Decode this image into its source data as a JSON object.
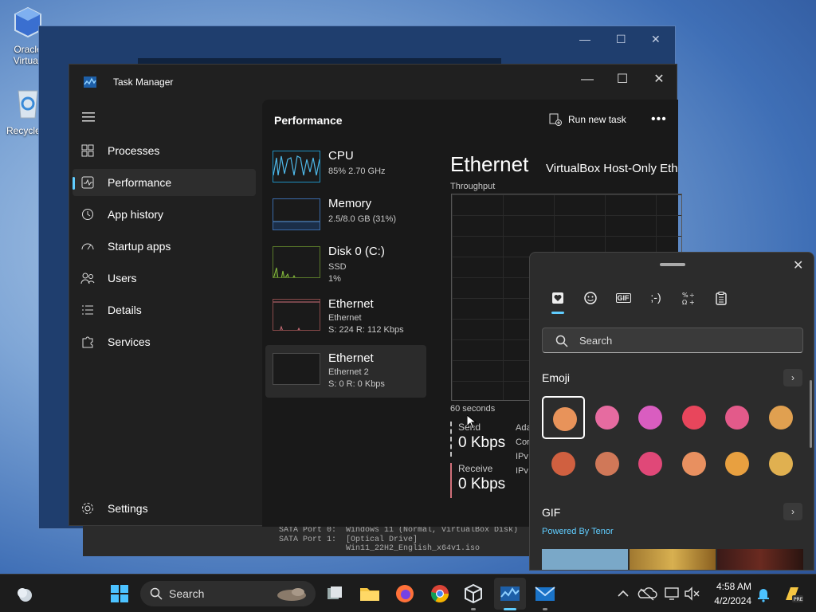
{
  "desktop": {
    "icons": [
      {
        "label": "Oracle Virtuall"
      },
      {
        "label": "Recycle"
      }
    ]
  },
  "vbox_strip": {
    "row1_left": "SATA Port 0:",
    "row1_right": "Windows 11 (Normal, VirtualBox Disk)",
    "row2_left": "SATA Port 1:",
    "row2_right": "[Optical Drive] Win11_22H2_English_x64v1.iso"
  },
  "task_manager": {
    "title": "Task Manager",
    "nav": [
      {
        "label": "Processes",
        "icon": "grid-icon"
      },
      {
        "label": "Performance",
        "icon": "pulse-icon",
        "active": true
      },
      {
        "label": "App history",
        "icon": "history-icon"
      },
      {
        "label": "Startup apps",
        "icon": "speedometer-icon"
      },
      {
        "label": "Users",
        "icon": "users-icon"
      },
      {
        "label": "Details",
        "icon": "list-icon"
      },
      {
        "label": "Services",
        "icon": "puzzle-icon"
      }
    ],
    "settings_label": "Settings",
    "page_title": "Performance",
    "run_new_task": "Run new task",
    "more": "•••",
    "resources": [
      {
        "name": "CPU",
        "sub1": "85% 2.70 GHz",
        "sub2": "",
        "sub3": ""
      },
      {
        "name": "Memory",
        "sub1": "2.5/8.0 GB (31%)",
        "sub2": "",
        "sub3": ""
      },
      {
        "name": "Disk 0 (C:)",
        "sub1": "SSD",
        "sub2": "1%",
        "sub3": ""
      },
      {
        "name": "Ethernet",
        "sub1": "Ethernet",
        "sub2": "S: 224 R: 112 Kbps",
        "sub3": ""
      },
      {
        "name": "Ethernet",
        "sub1": "Ethernet 2",
        "sub2": "S: 0 R: 0 Kbps",
        "sub3": "",
        "active": true
      }
    ],
    "detail": {
      "heading": "Ethernet",
      "adapter": "VirtualBox Host-Only Eth",
      "throughput_label": "Throughput",
      "seconds_label": "60 seconds",
      "send_label": "Send",
      "send_value": "0 Kbps",
      "receive_label": "Receive",
      "receive_value": "0 Kbps",
      "side_labels": [
        "Ada",
        "Cor",
        "IPv",
        "IPv"
      ]
    }
  },
  "emoji_panel": {
    "close": "✕",
    "tabs": [
      "favorites-icon",
      "emoji-icon",
      "gif-icon",
      "kaomoji-icon",
      "symbols-icon",
      "clipboard-icon"
    ],
    "gif_tab_label": "GIF",
    "kaomoji_tab_label": ";-)",
    "search_placeholder": "Search",
    "emoji_section": "Emoji",
    "gif_section": "GIF",
    "powered_by": "Powered By Tenor",
    "chevron": "›",
    "emojis": [
      {
        "name": "grinning-face",
        "color": "#e8935a"
      },
      {
        "name": "laughing-face",
        "color": "#e66ba0"
      },
      {
        "name": "heart-eyes-face",
        "color": "#d95dc0"
      },
      {
        "name": "red-heart",
        "color": "#e8465c"
      },
      {
        "name": "tears-of-joy-face",
        "color": "#e35a8a"
      },
      {
        "name": "winking-face",
        "color": "#e0a050"
      },
      {
        "name": "thumbs-up",
        "color": "#d06040"
      },
      {
        "name": "blushing-face",
        "color": "#d07858"
      },
      {
        "name": "heart-hands",
        "color": "#e04878"
      },
      {
        "name": "big-grin-face",
        "color": "#e89060"
      },
      {
        "name": "folded-hands",
        "color": "#e8a040"
      },
      {
        "name": "raised-hands",
        "color": "#e0b050"
      }
    ]
  },
  "taskbar": {
    "search_label": "Search",
    "time": "4:58 AM",
    "date": "4/2/2024"
  }
}
